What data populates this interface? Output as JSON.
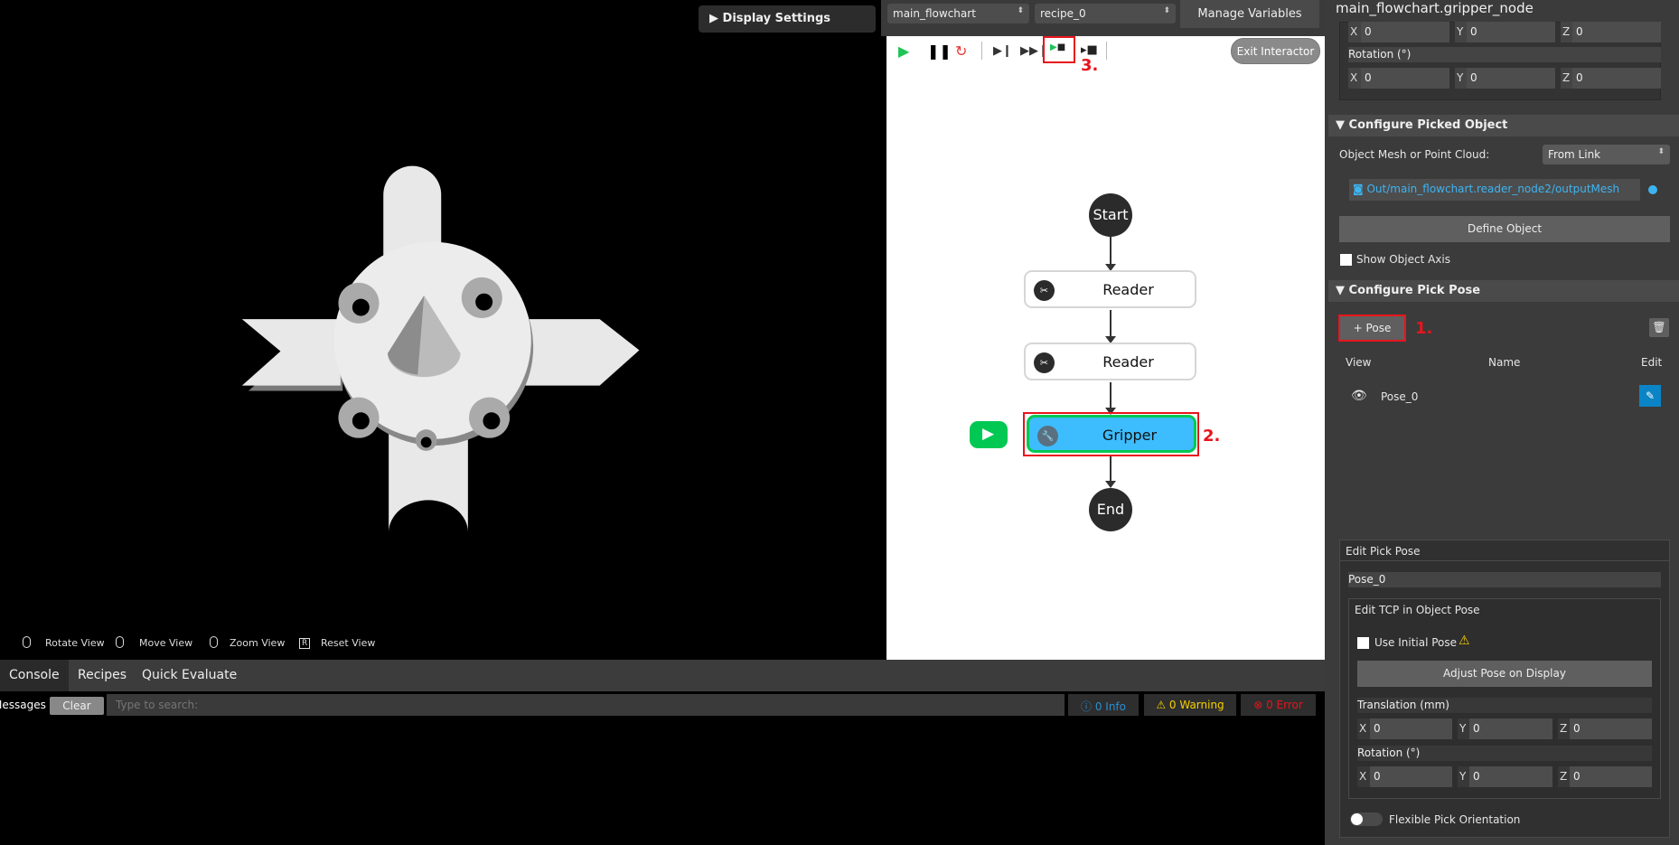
{
  "viewport": {
    "display_settings": "Display Settings",
    "hints": [
      "Rotate View",
      "Move View",
      "Zoom View",
      "Reset View"
    ],
    "reset_key": "R"
  },
  "flowchart": {
    "flowchart_select": "main_flowchart",
    "recipe_select": "recipe_0",
    "manage_variables": "Manage Variables",
    "exit_interactor": "Exit Interactor",
    "toolbar_icons": [
      "play-icon",
      "pause-icon",
      "restart-icon",
      "step-icon",
      "fast-forward-icon",
      "run-to-node-icon",
      "interactor-icon"
    ],
    "nodes": {
      "start": "Start",
      "reader1": "Reader",
      "reader2": "Reader",
      "gripper": "Gripper",
      "end": "End"
    },
    "annotations": {
      "a1": "1.",
      "a2": "2.",
      "a3": "3."
    },
    "colors": {
      "active_node": "#3dbdfd",
      "run_green": "#00c853",
      "highlight": "#e8141c"
    }
  },
  "right_panel": {
    "title": "main_flowchart.gripper_node",
    "top_translation": {
      "x": "0",
      "y": "0",
      "z": "0"
    },
    "rotation_label": "Rotation (°)",
    "top_rotation": {
      "x": "0",
      "y": "0",
      "z": "0"
    },
    "picked_object": {
      "header": "Configure Picked Object",
      "mesh_label": "Object Mesh or Point Cloud:",
      "mesh_value": "From Link",
      "link": "Out/main_flowchart.reader_node2/outputMesh",
      "define_button": "Define Object",
      "show_axis": "Show Object Axis"
    },
    "pick_pose": {
      "header": "Configure Pick Pose",
      "add_button": "+ Pose",
      "col_view": "View",
      "col_name": "Name",
      "col_edit": "Edit",
      "poses": [
        {
          "name": "Pose_0"
        }
      ]
    },
    "edit_pick_pose": {
      "header": "Edit Pick Pose",
      "name": "Pose_0",
      "tcp_header": "Edit TCP in Object Pose",
      "use_initial": "Use Initial Pose",
      "adjust_button": "Adjust Pose on Display",
      "translation_label": "Translation (mm)",
      "translation": {
        "x": "0",
        "y": "0",
        "z": "0"
      },
      "rotation_label": "Rotation (°)",
      "rotation": {
        "x": "0",
        "y": "0",
        "z": "0"
      },
      "flexible": "Flexible Pick Orientation"
    },
    "axes": {
      "x": "X",
      "y": "Y",
      "z": "Z"
    }
  },
  "console": {
    "tabs": [
      "Console",
      "Recipes",
      "Quick Evaluate"
    ],
    "messages_label": "Messages",
    "clear": "Clear",
    "search_placeholder": "Type to search:",
    "info": "0 Info",
    "warning": "0 Warning",
    "error": "0 Error"
  }
}
